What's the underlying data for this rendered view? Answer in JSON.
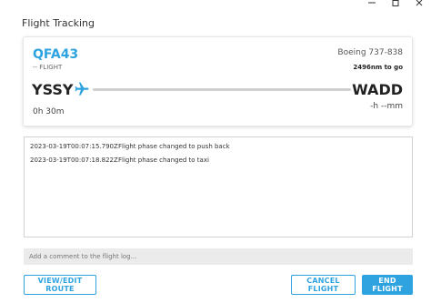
{
  "window": {
    "title": "Flight Tracking",
    "controls": [
      "minimize-icon",
      "maximize-icon",
      "close-icon"
    ]
  },
  "flight": {
    "callsign": "QFA43",
    "flight_number": "-- FLIGHT",
    "aircraft": "Boeing 737-838",
    "distance_to_go": "2496nm to go",
    "origin": "YSSY",
    "destination": "WADD",
    "elapsed": "0h 30m",
    "remaining": "-h --mm",
    "progress_icon": "airplane-icon"
  },
  "log": {
    "entries": [
      {
        "time": "2023-03-19T00:07:15.790Z",
        "message": "Flight phase changed to push back"
      },
      {
        "time": "2023-03-19T00:07:18.822Z",
        "message": "Flight phase changed to taxi"
      }
    ]
  },
  "comment": {
    "placeholder": "Add a comment to the flight log..."
  },
  "buttons": {
    "route": "VIEW/EDIT ROUTE",
    "cancel": "CANCEL FLIGHT",
    "end": "END FLIGHT"
  },
  "colors": {
    "accent": "#2fa3e0",
    "route_line": "#cfcfcf"
  }
}
